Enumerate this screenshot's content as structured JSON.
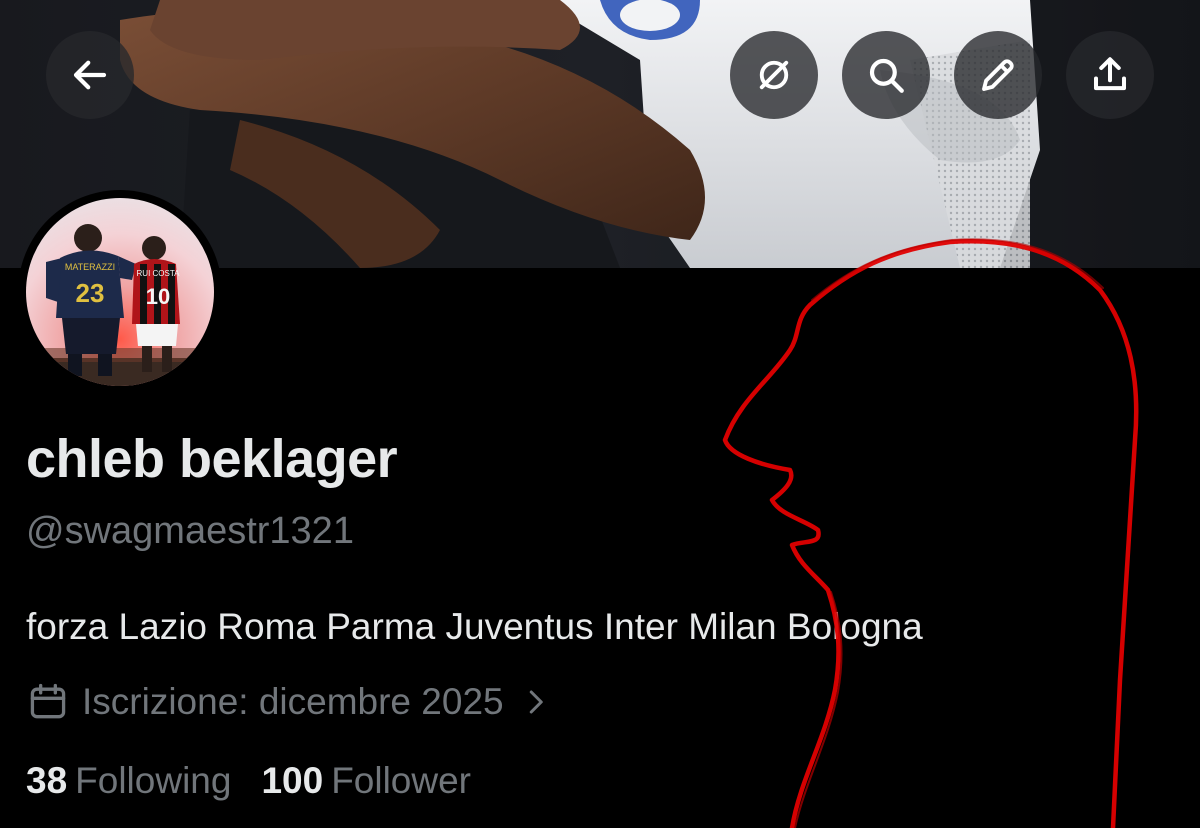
{
  "header": {
    "back": {
      "icon": "arrow-left-icon"
    },
    "actions": [
      {
        "name": "grok-button",
        "icon": "grok-icon"
      },
      {
        "name": "search-button",
        "icon": "search-icon"
      },
      {
        "name": "edit-button",
        "icon": "pencil-icon"
      },
      {
        "name": "share-button",
        "icon": "share-icon"
      }
    ]
  },
  "profile": {
    "display_name": "chleb beklager",
    "handle": "@swagmaestr1321",
    "bio": "forza Lazio Roma Parma Juventus Inter Milan Bologna",
    "joined": "Iscrizione: dicembre 2025",
    "avatar": {
      "left_jersey_name": "MATERAZZI",
      "left_jersey_number": "23",
      "right_jersey_name": "RUI COSTA",
      "right_jersey_number": "10"
    },
    "stats": {
      "following_count": "38",
      "following_label": "Following",
      "followers_count": "100",
      "followers_label": "Follower"
    }
  },
  "colors": {
    "background": "#000000",
    "primary_text": "#e7e9ea",
    "secondary_text": "#71767b",
    "button_bg": "#26282b",
    "doodle": "#e00000"
  }
}
